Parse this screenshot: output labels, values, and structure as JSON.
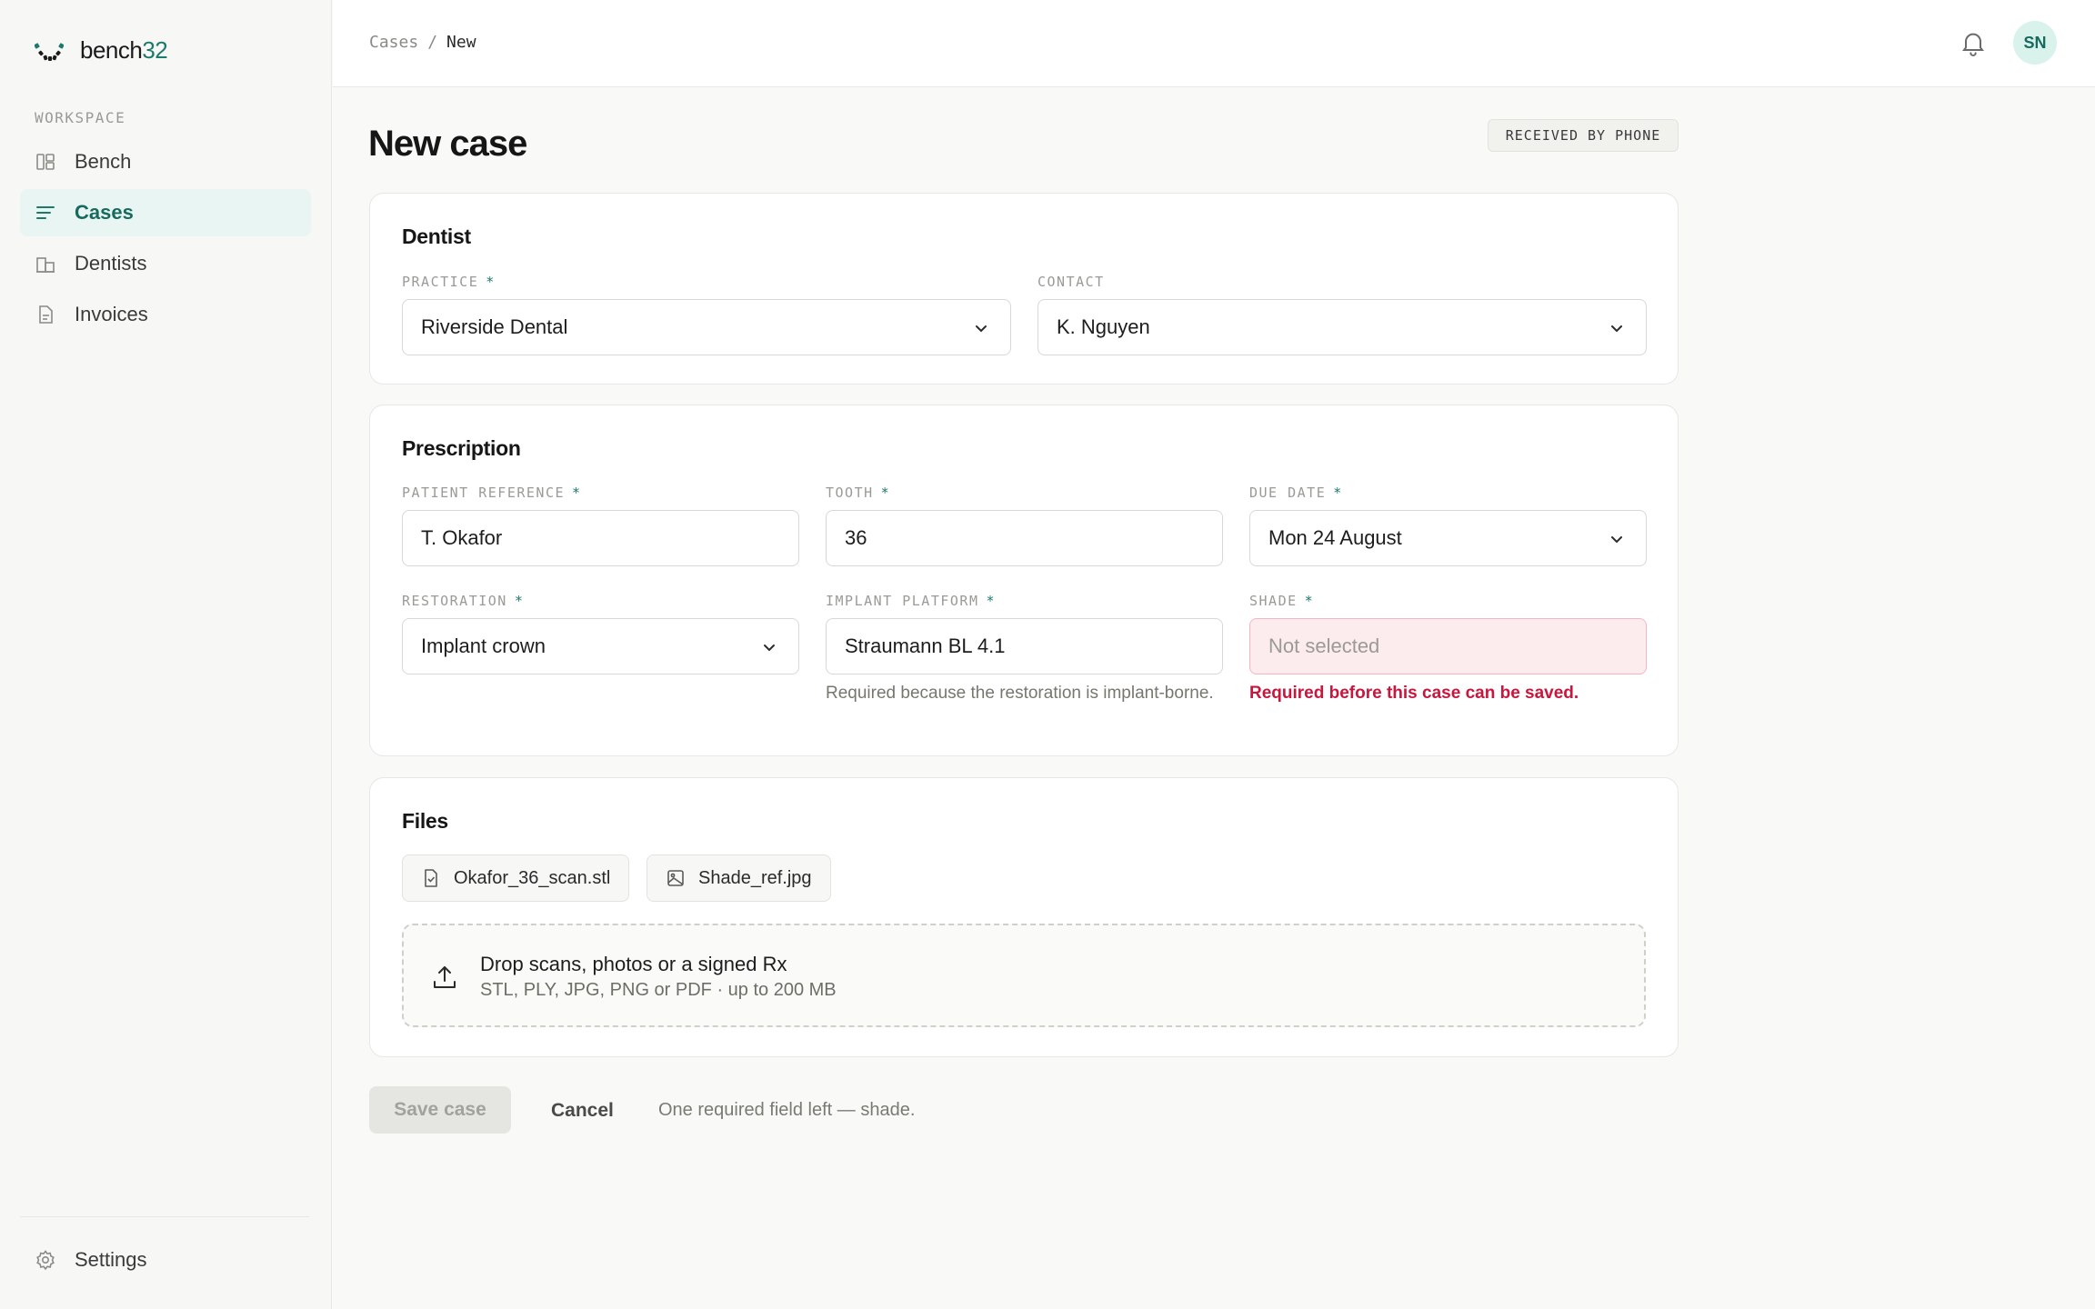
{
  "brand": {
    "name_prefix": "bench",
    "name_suffix": "32"
  },
  "sidebar": {
    "section_label": "WORKSPACE",
    "items": [
      {
        "label": "Bench",
        "icon": "board-icon",
        "active": false
      },
      {
        "label": "Cases",
        "icon": "list-icon",
        "active": true
      },
      {
        "label": "Dentists",
        "icon": "building-icon",
        "active": false
      },
      {
        "label": "Invoices",
        "icon": "document-icon",
        "active": false
      }
    ],
    "settings_label": "Settings"
  },
  "header": {
    "breadcrumb": {
      "parent": "Cases",
      "separator": "/",
      "current": "New"
    },
    "avatar_initials": "SN"
  },
  "page": {
    "title": "New case",
    "badge": "RECEIVED BY PHONE"
  },
  "dentist_card": {
    "title": "Dentist",
    "practice": {
      "label": "PRACTICE",
      "required_mark": "*",
      "value": "Riverside Dental"
    },
    "contact": {
      "label": "CONTACT",
      "value": "K. Nguyen"
    }
  },
  "prescription_card": {
    "title": "Prescription",
    "patient_reference": {
      "label": "PATIENT REFERENCE",
      "required_mark": "*",
      "value": "T. Okafor"
    },
    "tooth": {
      "label": "TOOTH",
      "required_mark": "*",
      "value": "36"
    },
    "due_date": {
      "label": "DUE DATE",
      "required_mark": "*",
      "value": "Mon 24 August"
    },
    "restoration": {
      "label": "RESTORATION",
      "required_mark": "*",
      "value": "Implant crown"
    },
    "implant_platform": {
      "label": "IMPLANT PLATFORM",
      "required_mark": "*",
      "value": "Straumann BL 4.1",
      "hint": "Required because the restoration is implant-borne."
    },
    "shade": {
      "label": "SHADE",
      "required_mark": "*",
      "placeholder": "Not selected",
      "error": "Required before this case can be saved."
    }
  },
  "files_card": {
    "title": "Files",
    "files": [
      {
        "name": "Okafor_36_scan.stl",
        "icon": "file-check-icon"
      },
      {
        "name": "Shade_ref.jpg",
        "icon": "image-icon"
      }
    ],
    "dropzone": {
      "title": "Drop scans, photos or a signed Rx",
      "subtitle": "STL, PLY, JPG, PNG or PDF · up to 200 MB"
    }
  },
  "actions": {
    "save_label": "Save case",
    "cancel_label": "Cancel",
    "status_note": "One required field left — shade."
  },
  "colors": {
    "accent": "#1c7a6c",
    "accent_bg": "#e9f5f2",
    "error": "#c8163d",
    "error_bg": "#fdecee"
  }
}
